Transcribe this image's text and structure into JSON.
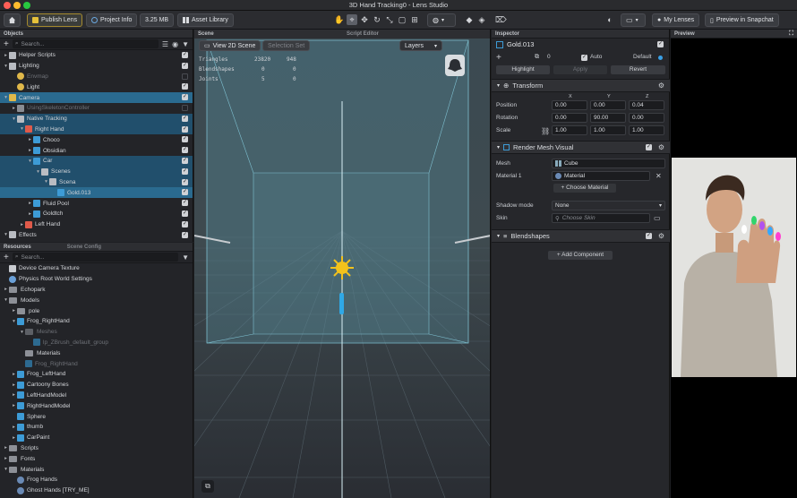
{
  "window": {
    "title": "3D Hand Tracking0 - Lens Studio"
  },
  "toolbar": {
    "publish": "Publish Lens",
    "project_info": "Project Info",
    "size": "3.25 MB",
    "asset_library": "Asset Library",
    "my_lenses": "My Lenses",
    "preview_snapchat": "Preview in Snapchat"
  },
  "objects_panel": {
    "title": "Objects",
    "search_placeholder": "Search...",
    "items": [
      {
        "label": "Helper Scripts",
        "depth": 0,
        "arrow": "▸",
        "icon": "scene-object-icon",
        "color": "#b9bcc2",
        "state": ""
      },
      {
        "label": "Lighting",
        "depth": 0,
        "arrow": "▾",
        "icon": "scene-object-icon",
        "color": "#b9bcc2",
        "state": ""
      },
      {
        "label": "Envmap",
        "depth": 1,
        "arrow": "",
        "icon": "light-icon",
        "color": "#e0b84a",
        "state": "dim"
      },
      {
        "label": "Light",
        "depth": 1,
        "arrow": "",
        "icon": "light-icon",
        "color": "#e0b84a",
        "state": ""
      },
      {
        "label": "Camera",
        "depth": 0,
        "arrow": "▾",
        "icon": "camera-icon",
        "color": "#e0b84a",
        "state": "sel"
      },
      {
        "label": "UsingSkeletonController",
        "depth": 1,
        "arrow": "▸",
        "icon": "scene-object-icon",
        "color": "#8a8d93",
        "state": "dim"
      },
      {
        "label": "Native Tracking",
        "depth": 1,
        "arrow": "▾",
        "icon": "scene-object-icon",
        "color": "#b9bcc2",
        "state": "sel2"
      },
      {
        "label": "Right Hand",
        "depth": 2,
        "arrow": "▾",
        "icon": "hand-icon",
        "color": "#e05a4a",
        "state": "sel2"
      },
      {
        "label": "Choco",
        "depth": 3,
        "arrow": "▸",
        "icon": "mesh-icon",
        "color": "#3d9bd6",
        "state": ""
      },
      {
        "label": "Obsidian",
        "depth": 3,
        "arrow": "▸",
        "icon": "mesh-icon",
        "color": "#3d9bd6",
        "state": ""
      },
      {
        "label": "Car",
        "depth": 3,
        "arrow": "▾",
        "icon": "mesh-icon",
        "color": "#3d9bd6",
        "state": "sel2"
      },
      {
        "label": "Scenes",
        "depth": 4,
        "arrow": "▾",
        "icon": "scene-object-icon",
        "color": "#b9bcc2",
        "state": "sel2"
      },
      {
        "label": "Scena",
        "depth": 5,
        "arrow": "▾",
        "icon": "scene-object-icon",
        "color": "#b9bcc2",
        "state": "sel2"
      },
      {
        "label": "Gold.013",
        "depth": 6,
        "arrow": "",
        "icon": "mesh-visual-icon",
        "color": "#3d9bd6",
        "state": "sel"
      },
      {
        "label": "Fluid Pool",
        "depth": 3,
        "arrow": "▸",
        "icon": "mesh-icon",
        "color": "#3d9bd6",
        "state": ""
      },
      {
        "label": "Goldtch",
        "depth": 3,
        "arrow": "▸",
        "icon": "mesh-icon",
        "color": "#3d9bd6",
        "state": ""
      },
      {
        "label": "Left Hand",
        "depth": 2,
        "arrow": "▸",
        "icon": "hand-icon",
        "color": "#e05a4a",
        "state": ""
      },
      {
        "label": "Effects",
        "depth": 0,
        "arrow": "▾",
        "icon": "scene-object-icon",
        "color": "#b9bcc2",
        "state": ""
      }
    ]
  },
  "resources_panel": {
    "tabs": [
      "Resources",
      "Scene Config"
    ],
    "search_placeholder": "Search...",
    "items": [
      {
        "label": "Device Camera Texture",
        "depth": 0,
        "arrow": "",
        "kind": "texture"
      },
      {
        "label": "Physics Root World Settings",
        "depth": 0,
        "arrow": "",
        "kind": "physics"
      },
      {
        "label": "Echopark",
        "depth": 0,
        "arrow": "▸",
        "kind": "folder"
      },
      {
        "label": "Models",
        "depth": 0,
        "arrow": "▾",
        "kind": "folder"
      },
      {
        "label": "pole",
        "depth": 1,
        "arrow": "▸",
        "kind": "folder"
      },
      {
        "label": "Frog_RightHand",
        "depth": 1,
        "arrow": "▾",
        "kind": "mesh"
      },
      {
        "label": "Meshes",
        "depth": 2,
        "arrow": "▾",
        "kind": "folder-dim"
      },
      {
        "label": "lp_ZBrush_default_group",
        "depth": 3,
        "arrow": "",
        "kind": "grid-dim"
      },
      {
        "label": "Materials",
        "depth": 2,
        "arrow": "",
        "kind": "folder"
      },
      {
        "label": "Frog_RightHand",
        "depth": 2,
        "arrow": "",
        "kind": "mesh-dim"
      },
      {
        "label": "Frog_LeftHand",
        "depth": 1,
        "arrow": "▸",
        "kind": "mesh"
      },
      {
        "label": "Cartoony Bones",
        "depth": 1,
        "arrow": "▸",
        "kind": "mesh"
      },
      {
        "label": "LeftHandModel",
        "depth": 1,
        "arrow": "▸",
        "kind": "mesh"
      },
      {
        "label": "RightHandModel",
        "depth": 1,
        "arrow": "▸",
        "kind": "mesh"
      },
      {
        "label": "Sphere",
        "depth": 1,
        "arrow": "",
        "kind": "grid"
      },
      {
        "label": "thumb",
        "depth": 1,
        "arrow": "▸",
        "kind": "mesh"
      },
      {
        "label": "CarPaint",
        "depth": 1,
        "arrow": "▸",
        "kind": "mesh"
      },
      {
        "label": "Scripts",
        "depth": 0,
        "arrow": "▸",
        "kind": "folder"
      },
      {
        "label": "Fonts",
        "depth": 0,
        "arrow": "▸",
        "kind": "folder"
      },
      {
        "label": "Materials",
        "depth": 0,
        "arrow": "▾",
        "kind": "folder"
      },
      {
        "label": "Frog Hands",
        "depth": 1,
        "arrow": "",
        "kind": "material"
      },
      {
        "label": "Ghost Hands [TRY_ME]",
        "depth": 1,
        "arrow": "",
        "kind": "material"
      }
    ]
  },
  "scene_panel": {
    "tabs": [
      "Scene",
      "Script Editor"
    ],
    "view_2d": "View 2D Scene",
    "selection_set": "Selection Set",
    "layers": "Layers",
    "stats": [
      {
        "label": "Triangles",
        "a": "23820",
        "b": "948"
      },
      {
        "label": "Blendshapes",
        "a": "0",
        "b": "0"
      },
      {
        "label": "Joints",
        "a": "5",
        "b": "0"
      }
    ]
  },
  "inspector": {
    "title": "Inspector",
    "object_name": "Gold.013",
    "layer_value": "0",
    "auto": "Auto",
    "default": "Default",
    "buttons": {
      "highlight": "Highlight",
      "apply": "Apply",
      "revert": "Revert"
    },
    "transform": {
      "title": "Transform",
      "axes": [
        "X",
        "Y",
        "Z"
      ],
      "rows": [
        {
          "label": "Position",
          "values": [
            "0.00",
            "0.00",
            "0.04"
          ]
        },
        {
          "label": "Rotation",
          "values": [
            "0.00",
            "90.00",
            "0.00"
          ]
        },
        {
          "label": "Scale",
          "values": [
            "1.00",
            "1.00",
            "1.00"
          ]
        }
      ]
    },
    "render_mesh": {
      "title": "Render Mesh Visual",
      "mesh_label": "Mesh",
      "mesh_value": "Cube",
      "material_label": "Material 1",
      "material_value": "Material",
      "choose_material": "Choose Material",
      "shadow_label": "Shadow mode",
      "shadow_value": "None",
      "skin_label": "Skin",
      "skin_placeholder": "Choose Skin"
    },
    "blendshapes": {
      "title": "Blendshapes"
    },
    "add_component": "Add Component"
  },
  "preview": {
    "title": "Preview"
  }
}
